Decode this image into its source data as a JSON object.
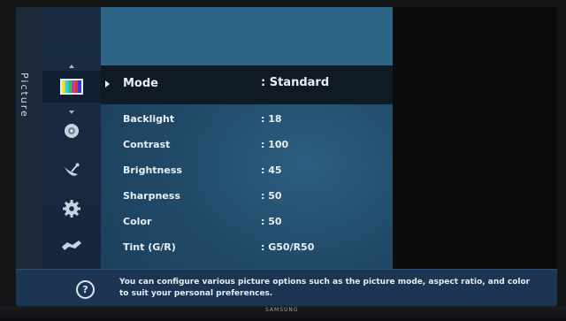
{
  "side_label": "Picture",
  "menu": {
    "selected": {
      "label": "Mode",
      "value": ": Standard"
    },
    "items": [
      {
        "label": "Backlight",
        "value": ": 18"
      },
      {
        "label": "Contrast",
        "value": ": 100"
      },
      {
        "label": "Brightness",
        "value": ": 45"
      },
      {
        "label": "Sharpness",
        "value": ": 50"
      },
      {
        "label": "Color",
        "value": ": 50"
      },
      {
        "label": "Tint (G/R)",
        "value": ": G50/R50"
      }
    ]
  },
  "icons": [
    "picture-icon",
    "sound-icon",
    "broadcast-icon",
    "settings-gear-icon",
    "support-icon"
  ],
  "help": {
    "icon": "?",
    "text": "You can configure various picture options such as the picture mode, aspect ratio, and color to suit your personal preferences."
  },
  "brand": "SAMSUNG"
}
